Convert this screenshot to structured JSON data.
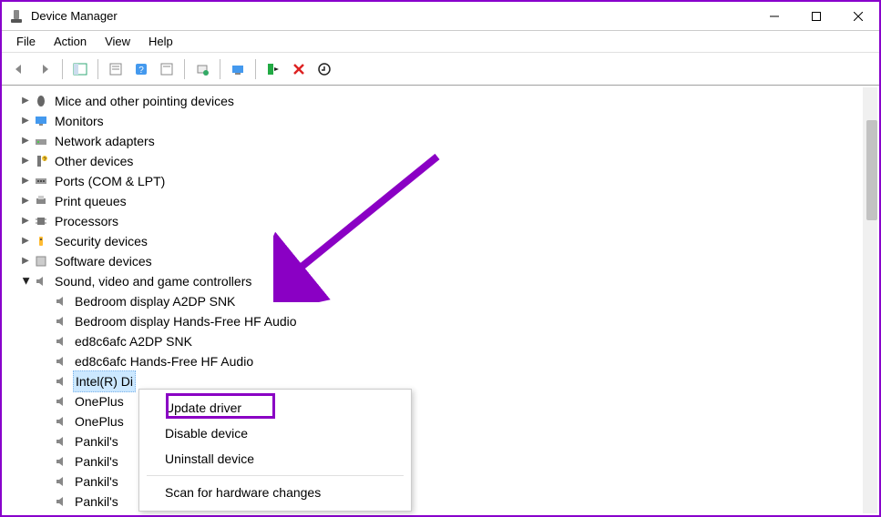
{
  "window": {
    "title": "Device Manager"
  },
  "menu": {
    "file": "File",
    "action": "Action",
    "view": "View",
    "help": "Help"
  },
  "tree": {
    "categories": [
      {
        "label": "Mice and other pointing devices",
        "icon": "mouse"
      },
      {
        "label": "Monitors",
        "icon": "monitor"
      },
      {
        "label": "Network adapters",
        "icon": "network"
      },
      {
        "label": "Other devices",
        "icon": "other"
      },
      {
        "label": "Ports (COM & LPT)",
        "icon": "port"
      },
      {
        "label": "Print queues",
        "icon": "printer"
      },
      {
        "label": "Processors",
        "icon": "cpu"
      },
      {
        "label": "Security devices",
        "icon": "security"
      },
      {
        "label": "Software devices",
        "icon": "software"
      }
    ],
    "expanded_category": "Sound, video and game controllers",
    "expanded_children": [
      "Bedroom display A2DP SNK",
      "Bedroom display Hands-Free HF Audio",
      "ed8c6afc A2DP SNK",
      "ed8c6afc Hands-Free HF Audio",
      "Intel(R) Di",
      "OnePlus",
      "OnePlus",
      "Pankil's",
      "Pankil's",
      "Pankil's",
      "Pankil's"
    ],
    "selected_index": 4
  },
  "context_menu": {
    "update": "Update driver",
    "disable": "Disable device",
    "uninstall": "Uninstall device",
    "scan": "Scan for hardware changes"
  }
}
